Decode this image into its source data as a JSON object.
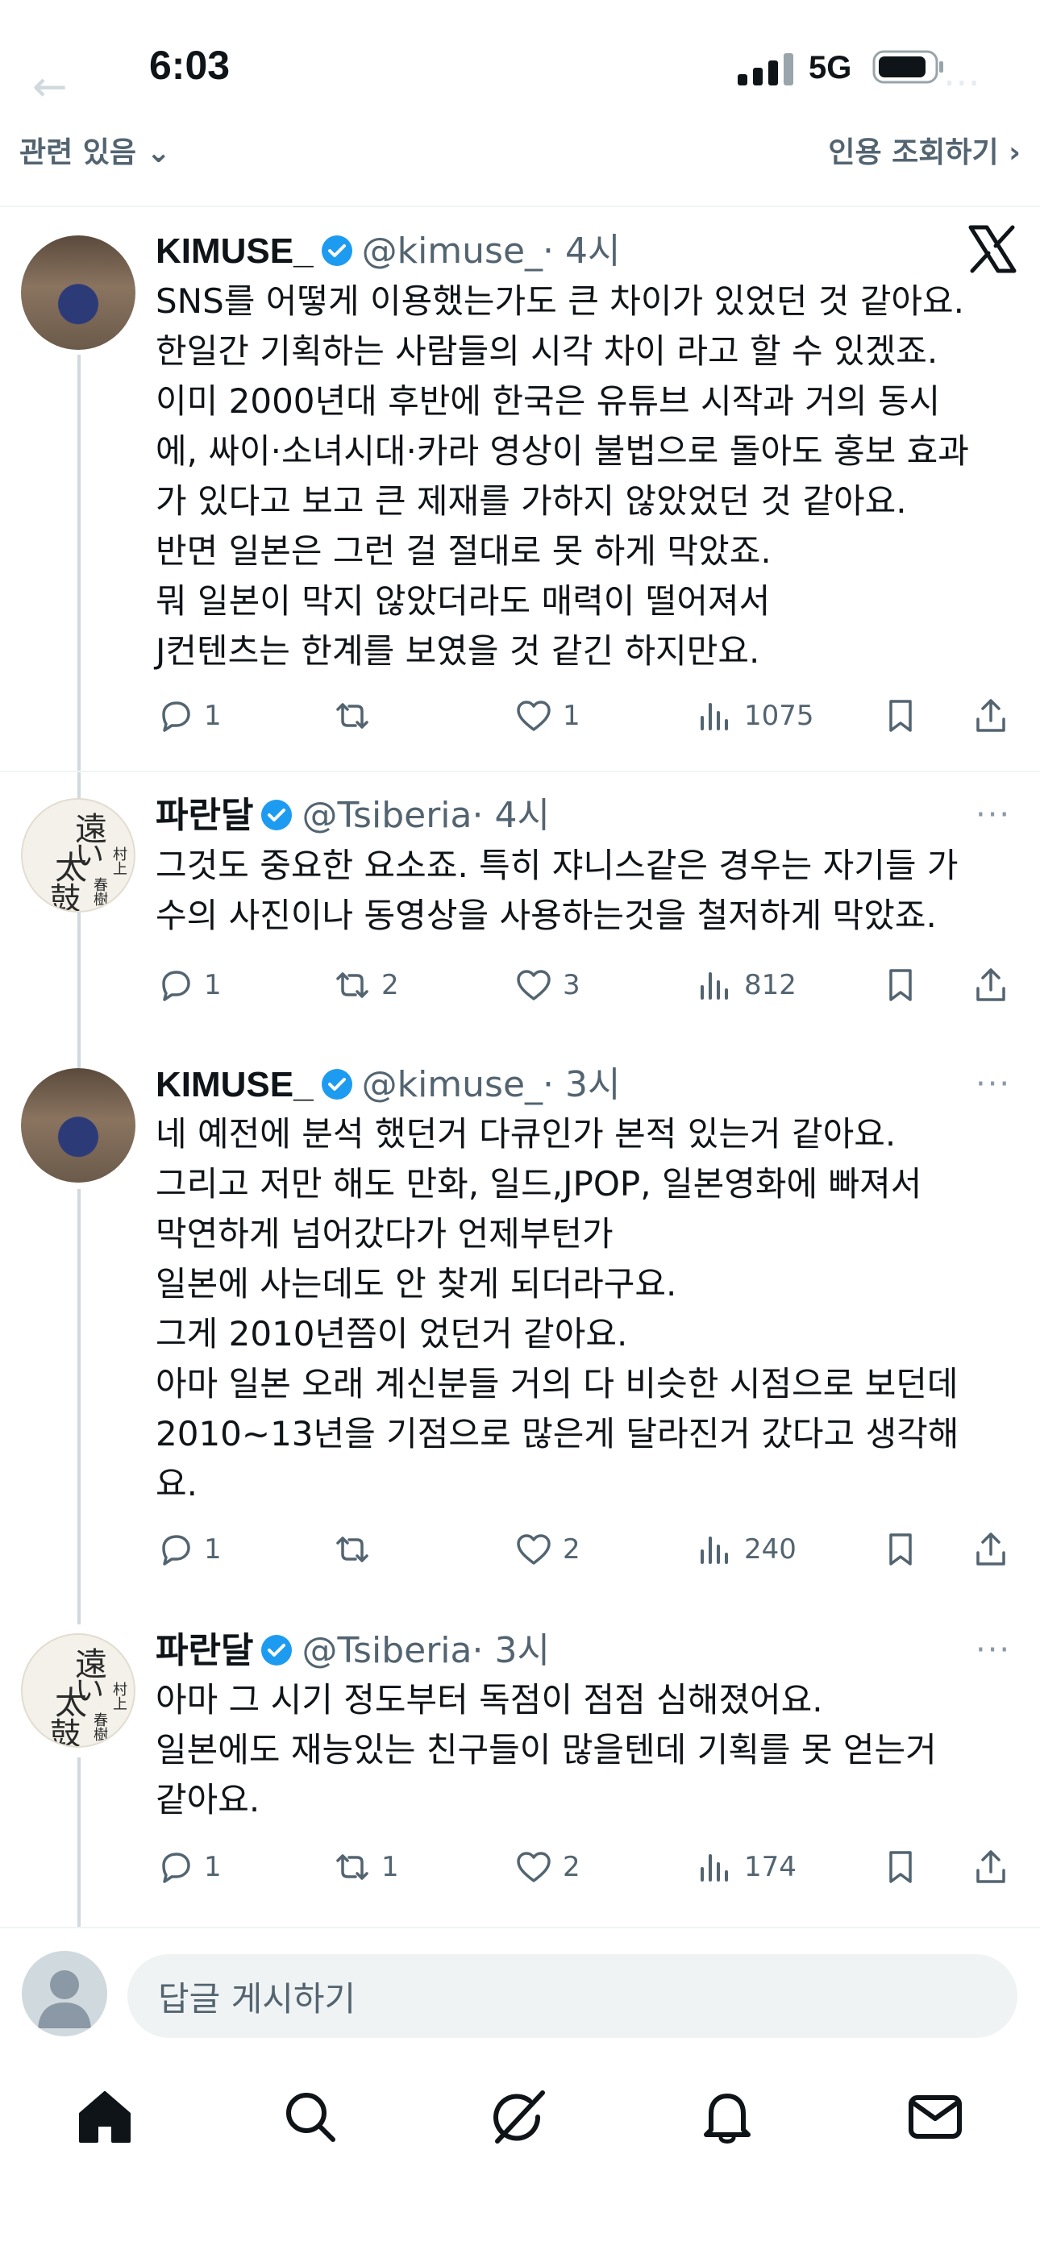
{
  "status_bar": {
    "time": "6:03",
    "network": "5G"
  },
  "top_bar": {
    "left": "관련 있음",
    "right": "인용 조회하기"
  },
  "tweets": [
    {
      "name": "KIMUSE_",
      "handle": "@kimuse_",
      "time": "· 4시",
      "text": "SNS를 어떻게 이용했는가도 큰 차이가 있었던 것 같아요.\n한일간 기획하는 사람들의 시각 차이 라고 할 수 있겠죠.\n이미 2000년대 후반에 한국은 유튜브 시작과 거의 동시\n에, 싸이·소녀시대·카라 영상이 불법으로 돌아도 홍보 효과\n가 있다고 보고 큰 제재를 가하지 않았었던 것 같아요.\n반면 일본은 그런 걸 절대로 못 하게 막았죠.\n뭐 일본이 막지 않았더라도 매력이 떨어져서\nJ컨텐츠는 한계를 보였을 것 같긴 하지만요.",
      "replies": "1",
      "reposts": "",
      "likes": "1",
      "views": "1075"
    },
    {
      "name": "파란달",
      "handle": "@Tsiberia",
      "time": "· 4시",
      "text": "그것도 중요한 요소죠. 특히 쟈니스같은 경우는 자기들 가\n수의 사진이나 동영상을 사용하는것을 철저하게 막았죠.",
      "replies": "1",
      "reposts": "2",
      "likes": "3",
      "views": "812"
    },
    {
      "name": "KIMUSE_",
      "handle": "@kimuse_",
      "time": "· 3시",
      "text": "네 예전에 분석 했던거 다큐인가 본적 있는거 같아요.\n그리고 저만 해도 만화, 일드,JPOP, 일본영화에 빠져서\n막연하게 넘어갔다가 언제부턴가\n일본에 사는데도 안 찾게 되더라구요.\n그게 2010년쯤이 었던거 같아요.\n아마 일본 오래 계신분들 거의 다 비슷한 시점으로 보던데\n2010~13년을 기점으로 많은게 달라진거 갔다고 생각해\n요.",
      "replies": "1",
      "reposts": "",
      "likes": "2",
      "views": "240"
    },
    {
      "name": "파란달",
      "handle": "@Tsiberia",
      "time": "· 3시",
      "text": "아마 그 시기 정도부터 독점이 점점 심해졌어요.\n일본에도 재능있는 친구들이 많을텐데 기획를 못 얻는거\n같아요.",
      "replies": "1",
      "reposts": "1",
      "likes": "2",
      "views": "174"
    }
  ],
  "book_avatar_text": {
    "large_1": "遠",
    "large_2": "い",
    "large_3": "太",
    "large_4": "鼓",
    "small_1": "村上",
    "small_2": "春樹"
  },
  "reply": {
    "placeholder": "답글 게시하기"
  },
  "icons": {
    "nav": [
      "home-icon",
      "search-icon",
      "grok-icon",
      "notifications-icon",
      "messages-icon"
    ],
    "actions": [
      "reply-icon",
      "repost-icon",
      "like-icon",
      "views-icon",
      "bookmark-icon",
      "share-icon"
    ]
  },
  "colors": {
    "accent": "#1d9bf0",
    "muted": "#536471",
    "text": "#0f1419"
  }
}
